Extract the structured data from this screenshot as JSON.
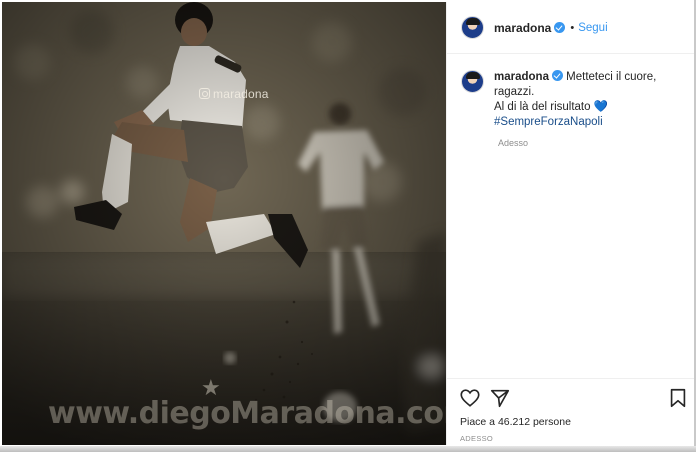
{
  "photo": {
    "watermark_handle": "maradona",
    "watermark_site": "www.diegoMaradona.com",
    "watermark_star": "★"
  },
  "header": {
    "username": "maradona",
    "separator": "•",
    "follow_label": "Segui"
  },
  "caption": {
    "username": "maradona",
    "line1": " Metteteci il cuore,",
    "line2": "ragazzi.",
    "line3": "Al di là del risultato ",
    "emoji": "💙",
    "hashtag": "#SempreForzaNapoli",
    "time": "Adesso"
  },
  "actions": {
    "likes_text": "Piace a 46.212 persone",
    "timestamp": "ADESSO"
  },
  "icons": [
    "heart-icon",
    "share-icon",
    "bookmark-icon",
    "verified-icon"
  ],
  "colors": {
    "link": "#3897f0",
    "text": "#262626",
    "muted": "#8e8e8e",
    "border": "#efefef"
  }
}
